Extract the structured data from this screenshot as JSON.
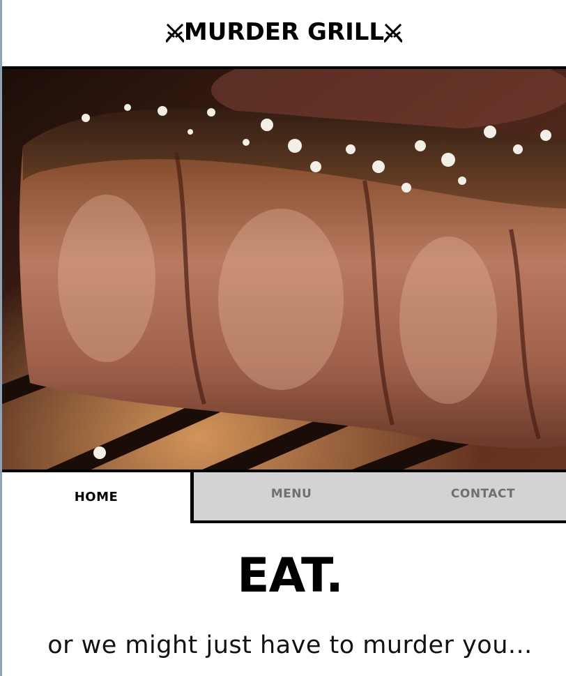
{
  "header": {
    "logo_text": "MURDER GRILL",
    "logo_icons": [
      "crossed-swords-icon",
      "crossed-swords-icon"
    ]
  },
  "hero": {
    "image": "grilled-steak-photo"
  },
  "nav": {
    "tabs": [
      {
        "label": "HOME",
        "active": true
      },
      {
        "label": "MENU",
        "active": false
      },
      {
        "label": "CONTACT",
        "active": false
      }
    ]
  },
  "main": {
    "headline": "EAT.",
    "tagline": "or we might just have to murder you..."
  },
  "colors": {
    "tab_inactive_bg": "#d3d3d3",
    "tab_inactive_text": "#6f6f6f",
    "text": "#000000",
    "border": "#000000"
  }
}
